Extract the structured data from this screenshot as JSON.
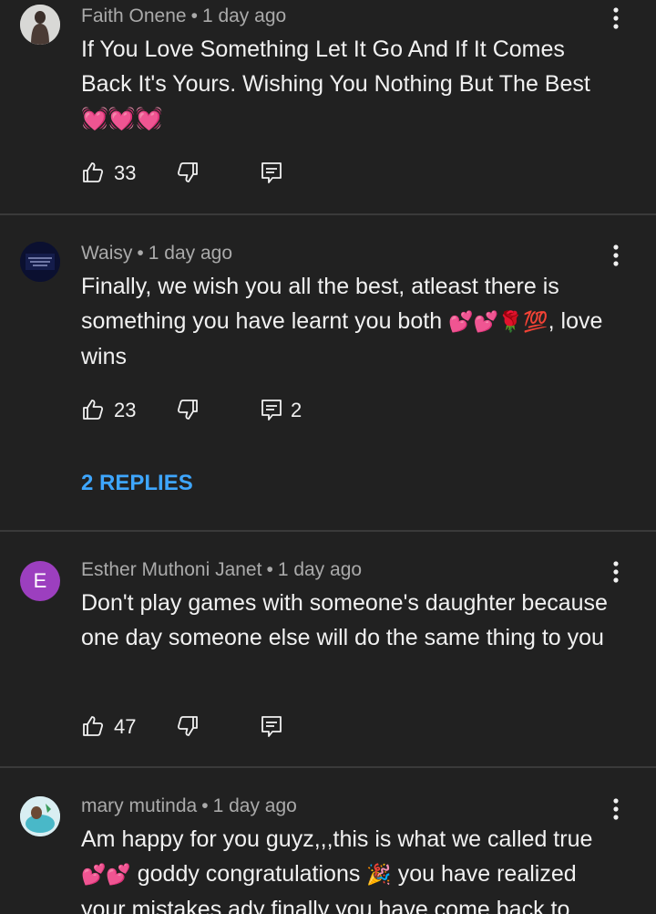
{
  "comments": [
    {
      "author": "Faith Onene",
      "time": "1 day ago",
      "text": "If You Love Something Let It Go And If It Comes Back It's Yours. Wishing You Nothing But The Best",
      "emoji": "💓💓💓",
      "likes": "33",
      "replies_count": ""
    },
    {
      "author": "Waisy",
      "time": "1 day ago",
      "text_before": "Finally, we wish you all the best, atleast there is something you have learnt you both",
      "emoji": "💕💕🌹💯",
      "text_after": ", love wins",
      "likes": "23",
      "replies_count": "2",
      "replies_link": "2 REPLIES"
    },
    {
      "author": "Esther Muthoni Janet",
      "time": "1 day ago",
      "avatar_letter": "E",
      "avatar_color": "#9c3fbf",
      "text": "Don't play games with someone's daughter because one day someone else will do the same thing to you",
      "likes": "47",
      "replies_count": ""
    },
    {
      "author": "mary mutinda",
      "time": "1 day ago",
      "text_before": "Am happy for you guyz,,,this is what we called true",
      "emoji1": "💕💕",
      "text_mid": "goddy congratulations",
      "emoji2": "🎉",
      "text_after": "you have realized your mistakes ady finally you have come back to"
    }
  ],
  "colors": {
    "background": "#212121",
    "text": "#f1f1f1",
    "meta": "#aaaaaa",
    "link": "#3ea6ff",
    "divider": "#3a3a3a"
  },
  "icons": [
    "like-icon",
    "dislike-icon",
    "reply-icon",
    "more-options-icon"
  ]
}
